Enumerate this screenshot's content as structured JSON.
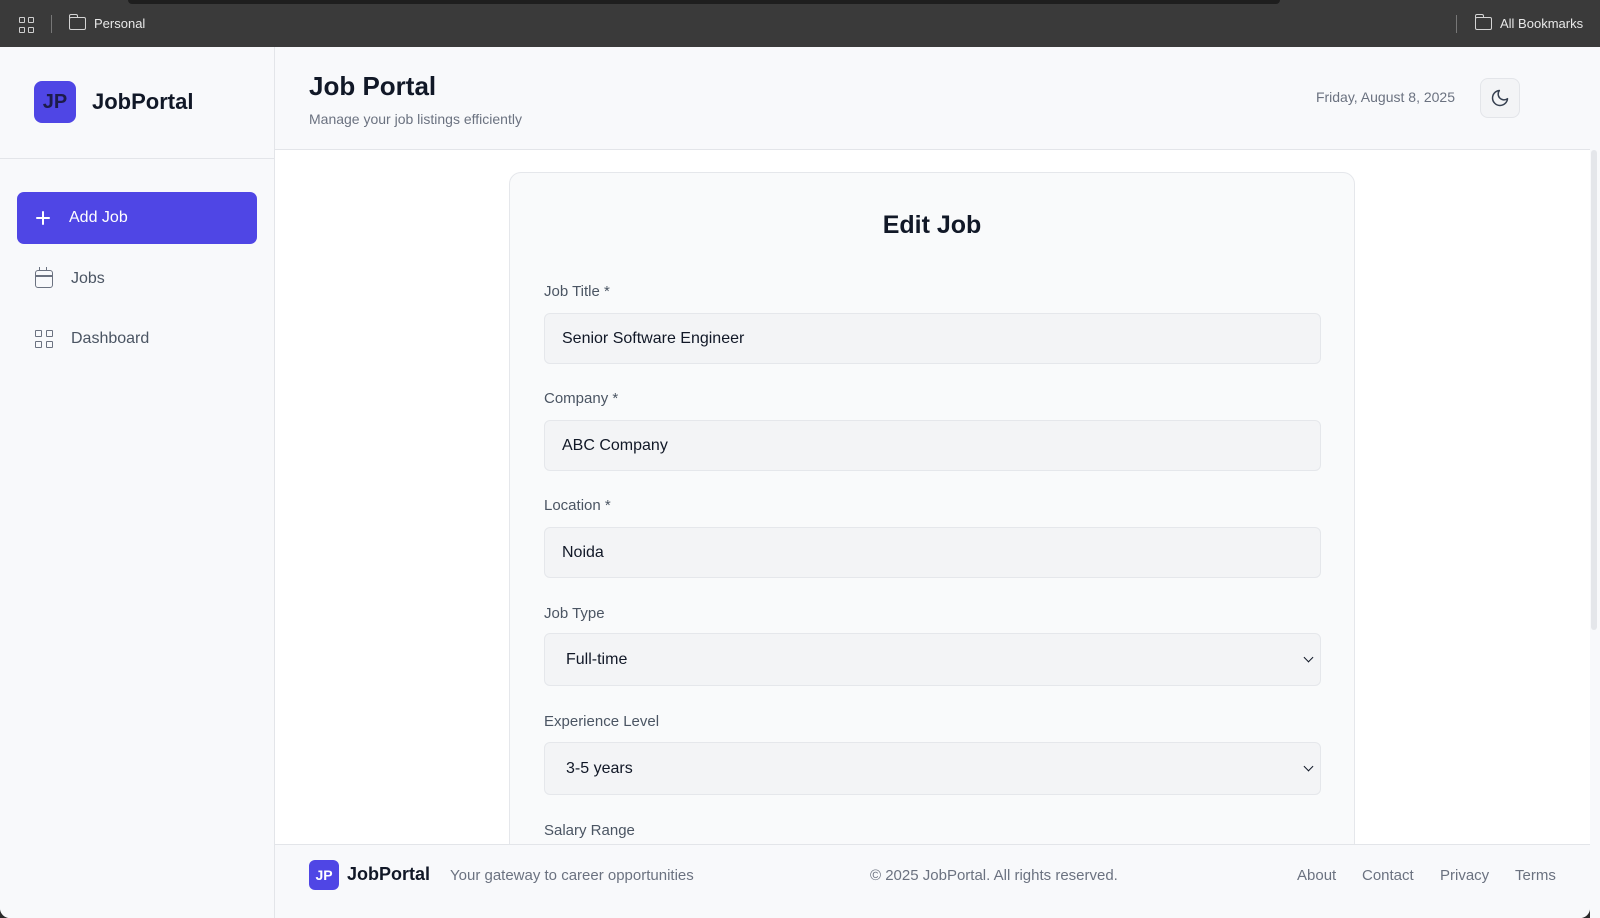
{
  "browser": {
    "bookmark_personal": "Personal",
    "bookmark_all": "All Bookmarks"
  },
  "brand": {
    "initials": "JP",
    "name": "JobPortal"
  },
  "sidebar": {
    "items": [
      {
        "label": "Add Job",
        "icon": "plus-icon"
      },
      {
        "label": "Jobs",
        "icon": "calendar-icon"
      },
      {
        "label": "Dashboard",
        "icon": "grid-icon"
      }
    ]
  },
  "header": {
    "title": "Job Portal",
    "subtitle": "Manage your job listings efficiently",
    "date": "Friday, August 8, 2025",
    "theme_icon": "moon-icon"
  },
  "form": {
    "title": "Edit Job",
    "job_title_label": "Job Title *",
    "job_title_value": "Senior Software Engineer",
    "company_label": "Company *",
    "company_value": "ABC Company",
    "location_label": "Location *",
    "location_value": "Noida",
    "job_type_label": "Job Type",
    "job_type_value": "Full-time",
    "experience_label": "Experience Level",
    "experience_value": "3-5 years",
    "salary_label": "Salary Range"
  },
  "footer": {
    "initials": "JP",
    "brand": "JobPortal",
    "tagline": "Your gateway to career opportunities",
    "copyright": "© 2025 JobPortal. All rights reserved.",
    "links": [
      "About",
      "Contact",
      "Privacy",
      "Terms"
    ]
  },
  "colors": {
    "accent": "#4f46e5",
    "background": "#f8f9fb",
    "text": "#111827",
    "muted": "#6b7280"
  }
}
